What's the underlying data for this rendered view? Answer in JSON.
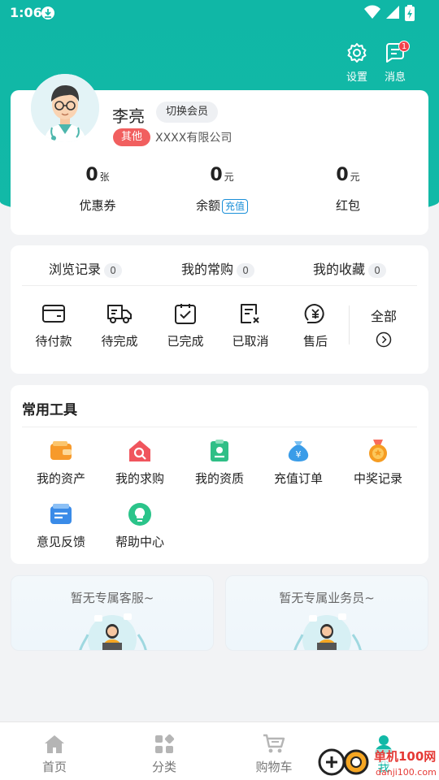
{
  "status_bar": {
    "time": "1:06"
  },
  "header": {
    "settings_label": "设置",
    "messages_label": "消息",
    "messages_badge": "1"
  },
  "profile": {
    "name": "李亮",
    "switch_label": "切换会员",
    "tag": "其他",
    "company": "XXXX有限公司"
  },
  "stats": [
    {
      "value": "0",
      "unit": "张",
      "label": "优惠券"
    },
    {
      "value": "0",
      "unit": "元",
      "label": "余额",
      "action": "充值"
    },
    {
      "value": "0",
      "unit": "元",
      "label": "红包"
    }
  ],
  "order_tabs": [
    {
      "label": "浏览记录",
      "count": "0"
    },
    {
      "label": "我的常购",
      "count": "0"
    },
    {
      "label": "我的收藏",
      "count": "0"
    }
  ],
  "order_status": [
    {
      "label": "待付款",
      "icon": "wallet-icon"
    },
    {
      "label": "待完成",
      "icon": "truck-icon"
    },
    {
      "label": "已完成",
      "icon": "clipboard-check-icon"
    },
    {
      "label": "已取消",
      "icon": "cancel-doc-icon"
    },
    {
      "label": "售后",
      "icon": "refund-icon"
    }
  ],
  "all_orders_label": "全部",
  "tools": {
    "title": "常用工具",
    "items": [
      {
        "label": "我的资产",
        "icon": "wallet-asset-icon",
        "color": "#f79a2b"
      },
      {
        "label": "我的求购",
        "icon": "search-house-icon",
        "color": "#f0555d"
      },
      {
        "label": "我的资质",
        "icon": "certificate-icon",
        "color": "#2fbf86"
      },
      {
        "label": "充值订单",
        "icon": "money-bag-icon",
        "color": "#3a9ce8"
      },
      {
        "label": "中奖记录",
        "icon": "medal-icon",
        "color": "#f59c22"
      },
      {
        "label": "意见反馈",
        "icon": "feedback-icon",
        "color": "#3a8be8"
      },
      {
        "label": "帮助中心",
        "icon": "bulb-icon",
        "color": "#2bc48a"
      }
    ]
  },
  "service": {
    "customer_service": "暂无专属客服~",
    "salesperson": "暂无专属业务员~"
  },
  "tabbar": [
    {
      "label": "首页",
      "icon": "home-icon"
    },
    {
      "label": "分类",
      "icon": "category-icon"
    },
    {
      "label": "购物车",
      "icon": "cart-icon"
    },
    {
      "label": "我",
      "icon": "user-icon",
      "active": true
    }
  ],
  "colors": {
    "primary": "#12b9a7",
    "tag": "#f15f5f",
    "link": "#1a8fd8"
  }
}
